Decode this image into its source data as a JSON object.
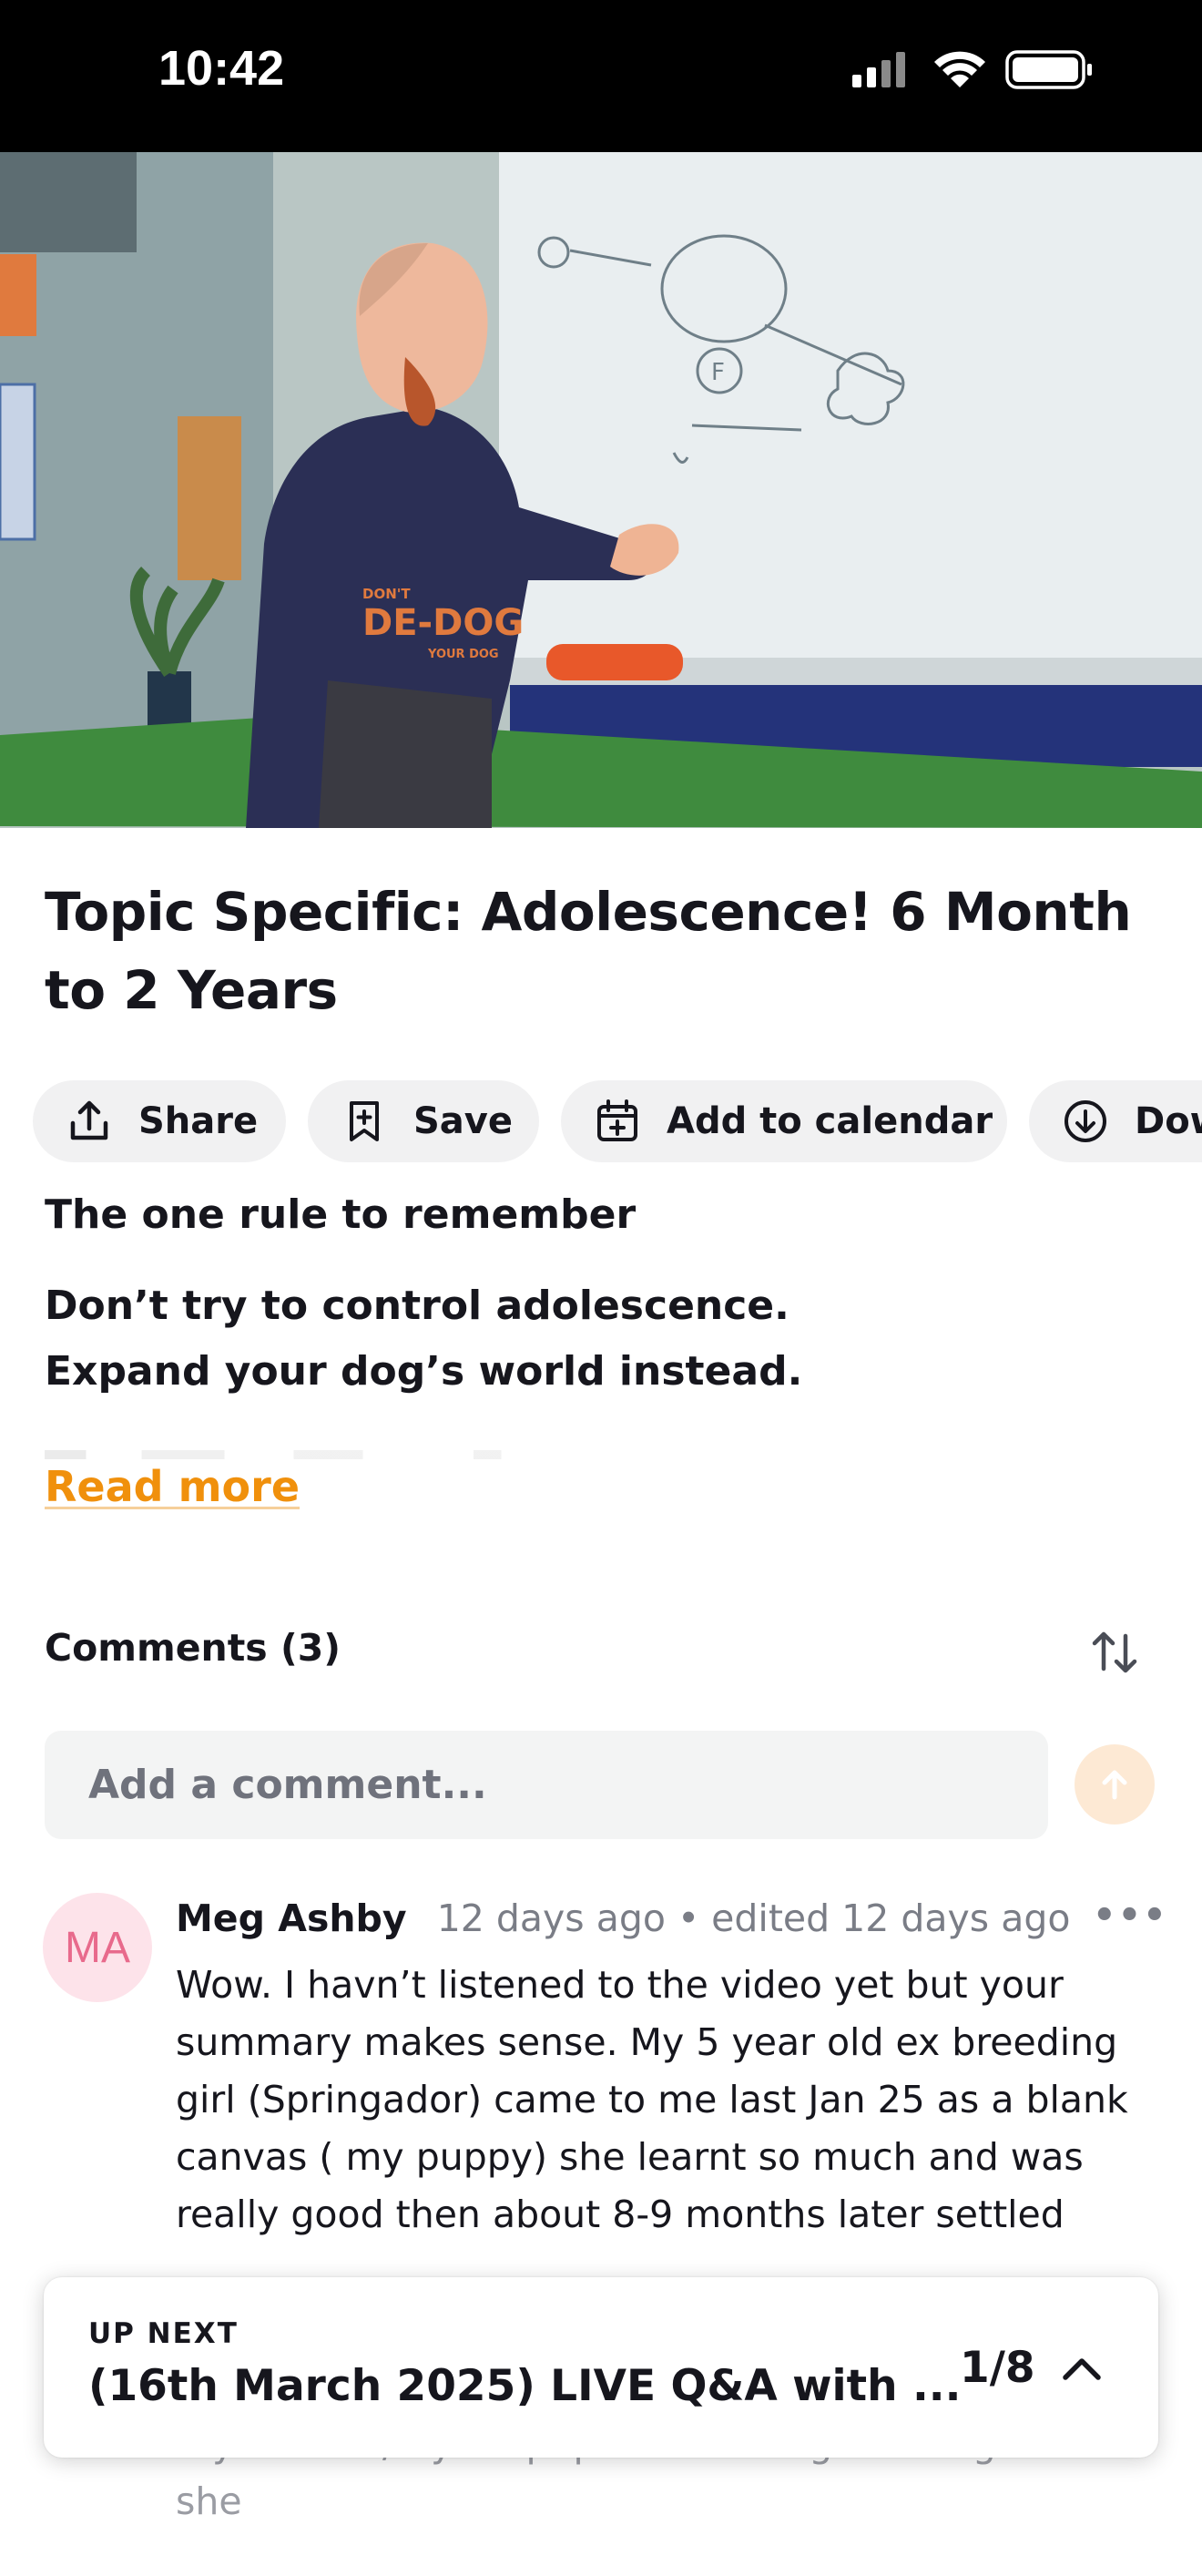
{
  "status_bar": {
    "time": "10:42",
    "icons": [
      "cellular-signal-icon",
      "wifi-icon",
      "battery-icon"
    ]
  },
  "video": {
    "thumbnail_icon": "video-thumbnail",
    "hoodie_text": [
      "DON'T",
      "DE-DOG",
      "YOUR DOG"
    ],
    "whiteboard_letter": "F"
  },
  "post": {
    "title": "Topic Specific: Adolescence! 6 Month to 2 Years"
  },
  "actions": [
    {
      "label": "Share",
      "icon": "share-icon"
    },
    {
      "label": "Save",
      "icon": "bookmark-plus-icon"
    },
    {
      "label": "Add to calendar",
      "icon": "calendar-plus-icon"
    },
    {
      "label": "Dow",
      "icon": "download-icon"
    }
  ],
  "description": {
    "heading": "The one rule to remember",
    "line1": "Don’t try to control adolescence.",
    "line2": "Expand your dog’s world instead.",
    "read_more": "Read more"
  },
  "comments": {
    "header": "Comments (3)",
    "sort_icon": "sort-arrows-icon",
    "input_placeholder": "Add a comment...",
    "send_icon": "send-arrow-up-icon",
    "items": [
      {
        "avatar_initials": "MA",
        "author": "Meg Ashby",
        "time": "12 days ago • edited 12 days ago",
        "more_icon": "ellipsis-icon",
        "body": "Wow. I havn’t listened to the video yet but your summary makes sense. My 5 year old ex breeding girl (Springador) came to me last Jan 25 as a blank canvas ( my puppy) she learnt so much and was really good then about 8-9 months later settled",
        "body_tail": "my now 61/2 year pup. Am I wrong thinking that she"
      }
    ]
  },
  "up_next": {
    "label": "UP NEXT",
    "title": "(16th March 2025) LIVE Q&A with ...",
    "count": "1/8",
    "chevron_icon": "chevron-up-icon"
  },
  "colors": {
    "accent": "#f0900c",
    "avatar_bg": "#fde3ea",
    "avatar_text": "#e86a8c",
    "chip_bg": "#f1f1f2"
  }
}
